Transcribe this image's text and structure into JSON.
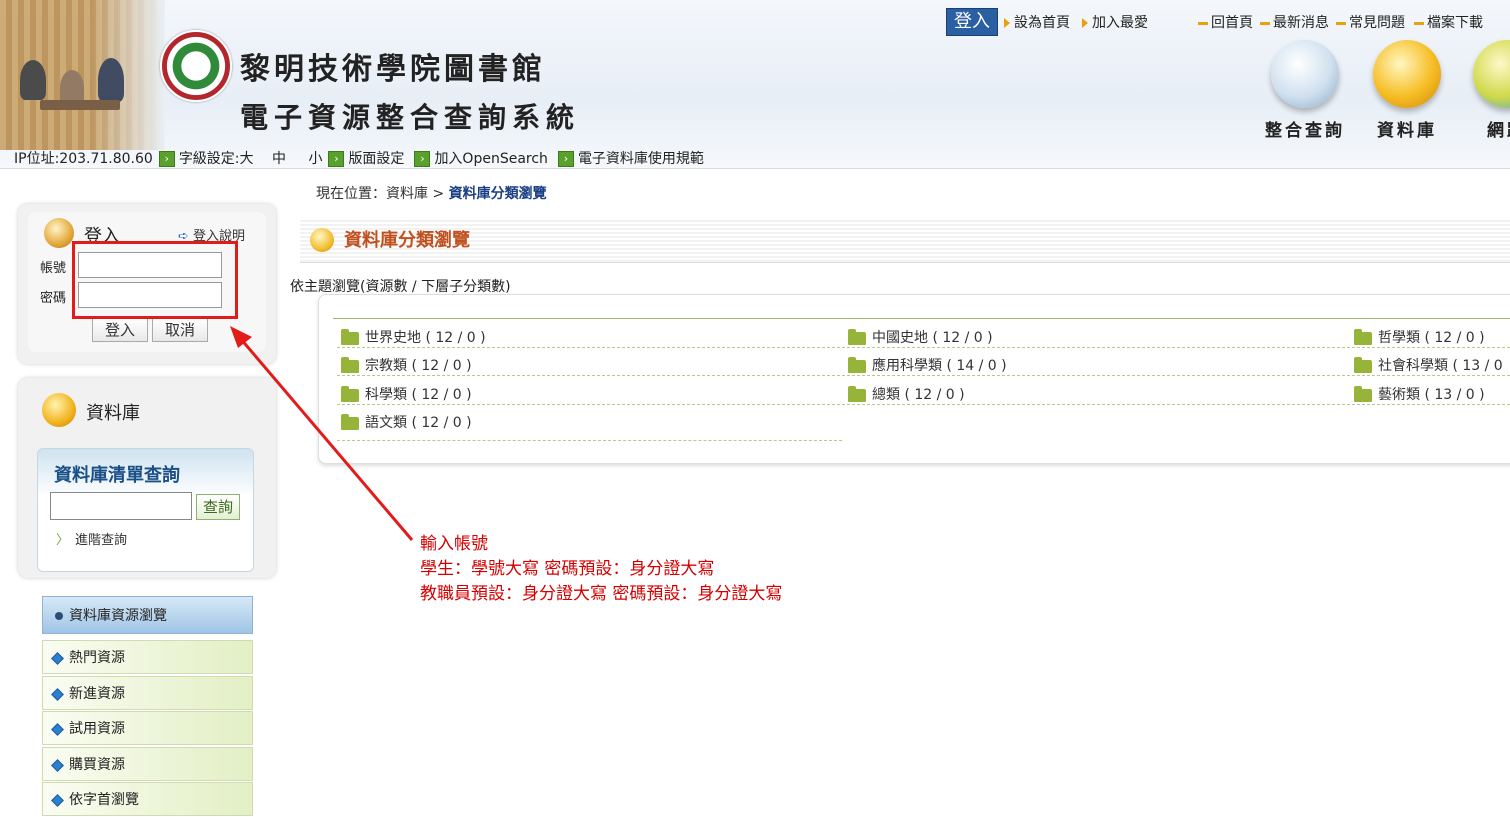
{
  "header": {
    "site_title": "黎明技術學院圖書館",
    "site_subtitle": "電子資源整合查詢系統",
    "login_button": "登入",
    "links": [
      "設為首頁",
      "加入最愛"
    ],
    "quick_links": [
      "回首頁",
      "最新消息",
      "常見問題",
      "檔案下載"
    ],
    "nav": [
      {
        "label": "整合查詢",
        "icon": "magnifier-book-icon"
      },
      {
        "label": "資料庫",
        "icon": "database-coins-icon"
      },
      {
        "label": "網路",
        "icon": "network-globe-icon"
      }
    ]
  },
  "infobar": {
    "ip": "IP位址:203.71.80.60",
    "font_size_label": "字級設定:大",
    "font_mid": "中",
    "font_small": "小",
    "layout": "版面設定",
    "opensearch": "加入OpenSearch",
    "rules": "電子資料庫使用規範"
  },
  "breadcrumb": {
    "prefix": "現在位置：資料庫 >",
    "current": "資料庫分類瀏覽"
  },
  "login": {
    "heading": "登入",
    "help": "登入說明",
    "account_label": "帳號",
    "password_label": "密碼",
    "account_value": "",
    "password_value": "",
    "submit": "登入",
    "cancel": "取消"
  },
  "database": {
    "heading": "資料庫",
    "search_title": "資料庫清單查詢",
    "search_value": "",
    "search_button": "查詢",
    "advanced": "進階查詢"
  },
  "menu": {
    "active": "資料庫資源瀏覽",
    "items": [
      "熱門資源",
      "新進資源",
      "試用資源",
      "購買資源",
      "依字首瀏覽"
    ]
  },
  "main": {
    "title": "資料庫分類瀏覽",
    "subtitle": "依主題瀏覽(資源數 / 下層子分類數)",
    "categories": [
      "世界史地 ( 12 / 0 )",
      "中國史地 ( 12 / 0 )",
      "哲學類 ( 12 / 0 )",
      "宗教類 ( 12 / 0 )",
      "應用科學類 ( 14 / 0 )",
      "社會科學類 ( 13 / 0",
      "科學類 ( 12 / 0 )",
      "總類 ( 12 / 0 )",
      "藝術類 ( 13 / 0 )",
      "語文類 ( 12 / 0 )"
    ]
  },
  "annotation": {
    "line1": "輸入帳號",
    "line2": "學生：學號大寫  密碼預設：身分證大寫",
    "line3": "教職員預設：身分證大寫  密碼預設：身分證大寫",
    "color": "#d40000"
  }
}
